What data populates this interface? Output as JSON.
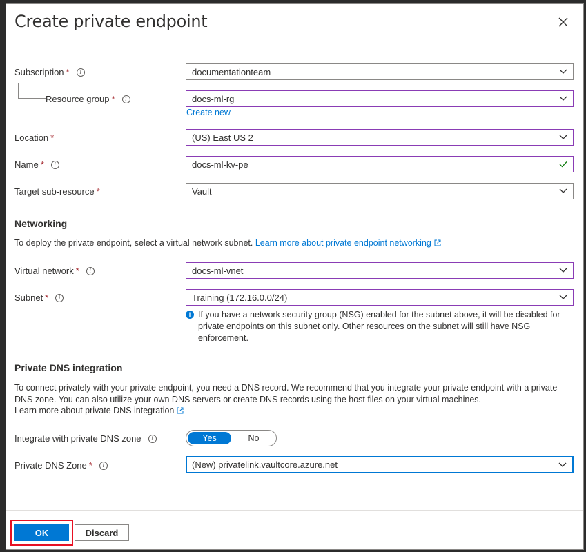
{
  "dialog": {
    "title": "Create private endpoint",
    "close_icon": "close-icon"
  },
  "fields": {
    "subscription": {
      "label": "Subscription",
      "value": "documentationteam"
    },
    "resource_group": {
      "label": "Resource group",
      "value": "docs-ml-rg",
      "create_new": "Create new"
    },
    "location": {
      "label": "Location",
      "value": "(US) East US 2"
    },
    "name": {
      "label": "Name",
      "value": "docs-ml-kv-pe"
    },
    "target_sub_resource": {
      "label": "Target sub-resource",
      "value": "Vault"
    }
  },
  "networking": {
    "heading": "Networking",
    "description": "To deploy the private endpoint, select a virtual network subnet.",
    "learn_more": "Learn more about private endpoint networking",
    "virtual_network": {
      "label": "Virtual network",
      "value": "docs-ml-vnet"
    },
    "subnet": {
      "label": "Subnet",
      "value": "Training (172.16.0.0/24)"
    },
    "nsg_note": "If you have a network security group (NSG) enabled for the subnet above, it will be disabled for private endpoints on this subnet only. Other resources on the subnet will still have NSG enforcement."
  },
  "dns": {
    "heading": "Private DNS integration",
    "description": "To connect privately with your private endpoint, you need a DNS record. We recommend that you integrate your private endpoint with a private DNS zone. You can also utilize your own DNS servers or create DNS records using the host files on your virtual machines.",
    "learn_more": "Learn more about private DNS integration",
    "integrate": {
      "label": "Integrate with private DNS zone",
      "yes": "Yes",
      "no": "No",
      "selected": "Yes"
    },
    "zone": {
      "label": "Private DNS Zone",
      "value": "(New) privatelink.vaultcore.azure.net"
    }
  },
  "footer": {
    "ok_label": "OK",
    "discard_label": "Discard"
  },
  "colors": {
    "accent": "#0078d4",
    "required": "#a4262c",
    "highlight": "#e81123",
    "valid": "#107c10"
  }
}
